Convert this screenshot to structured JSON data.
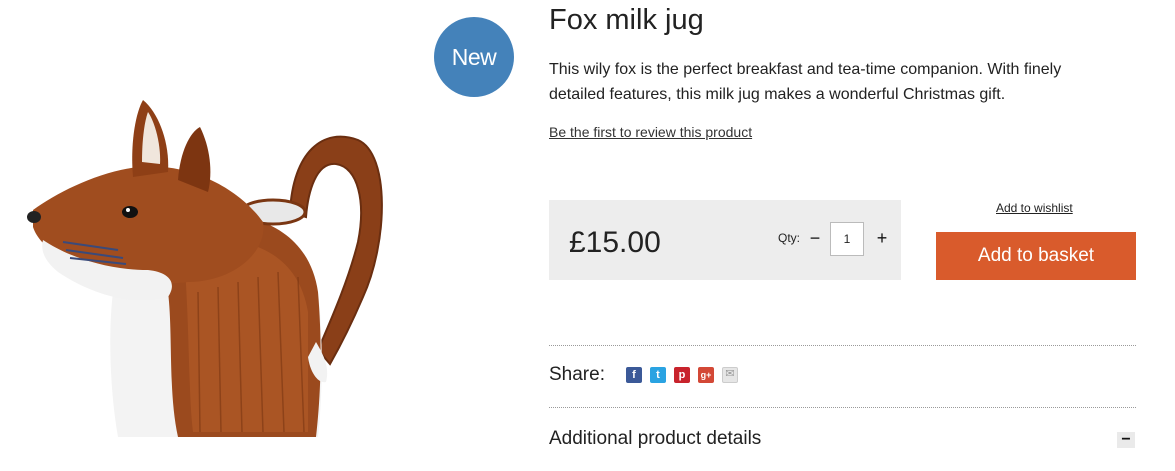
{
  "product": {
    "badge": "New",
    "title": "Fox milk jug",
    "description": "This wily fox is the perfect breakfast and tea-time companion. With finely detailed features, this milk jug makes a wonderful Christmas gift.",
    "review_link": "Be the first to review this product",
    "price": "£15.00",
    "image_subject": "fox-shaped ceramic milk jug"
  },
  "purchase": {
    "qty_label": "Qty:",
    "qty_value": "1",
    "qty_minus": "−",
    "qty_plus": "+",
    "wishlist_link": "Add to wishlist",
    "basket_button": "Add to basket"
  },
  "share": {
    "label": "Share:",
    "icons": [
      {
        "name": "facebook-icon",
        "color": "#3b5998",
        "glyph": "f"
      },
      {
        "name": "twitter-icon",
        "color": "#2aa3e2",
        "glyph": "t"
      },
      {
        "name": "pinterest-icon",
        "color": "#c8232c",
        "glyph": "p"
      },
      {
        "name": "google-plus-icon",
        "color": "#d34836",
        "glyph": "g+"
      },
      {
        "name": "email-icon",
        "color": "#e6e6e6",
        "glyph": "✉"
      }
    ]
  },
  "details": {
    "title": "Additional product details",
    "toggle": "−"
  },
  "colors": {
    "badge": "#4482ba",
    "basket_button": "#d95b2c",
    "price_box": "#ededed"
  }
}
